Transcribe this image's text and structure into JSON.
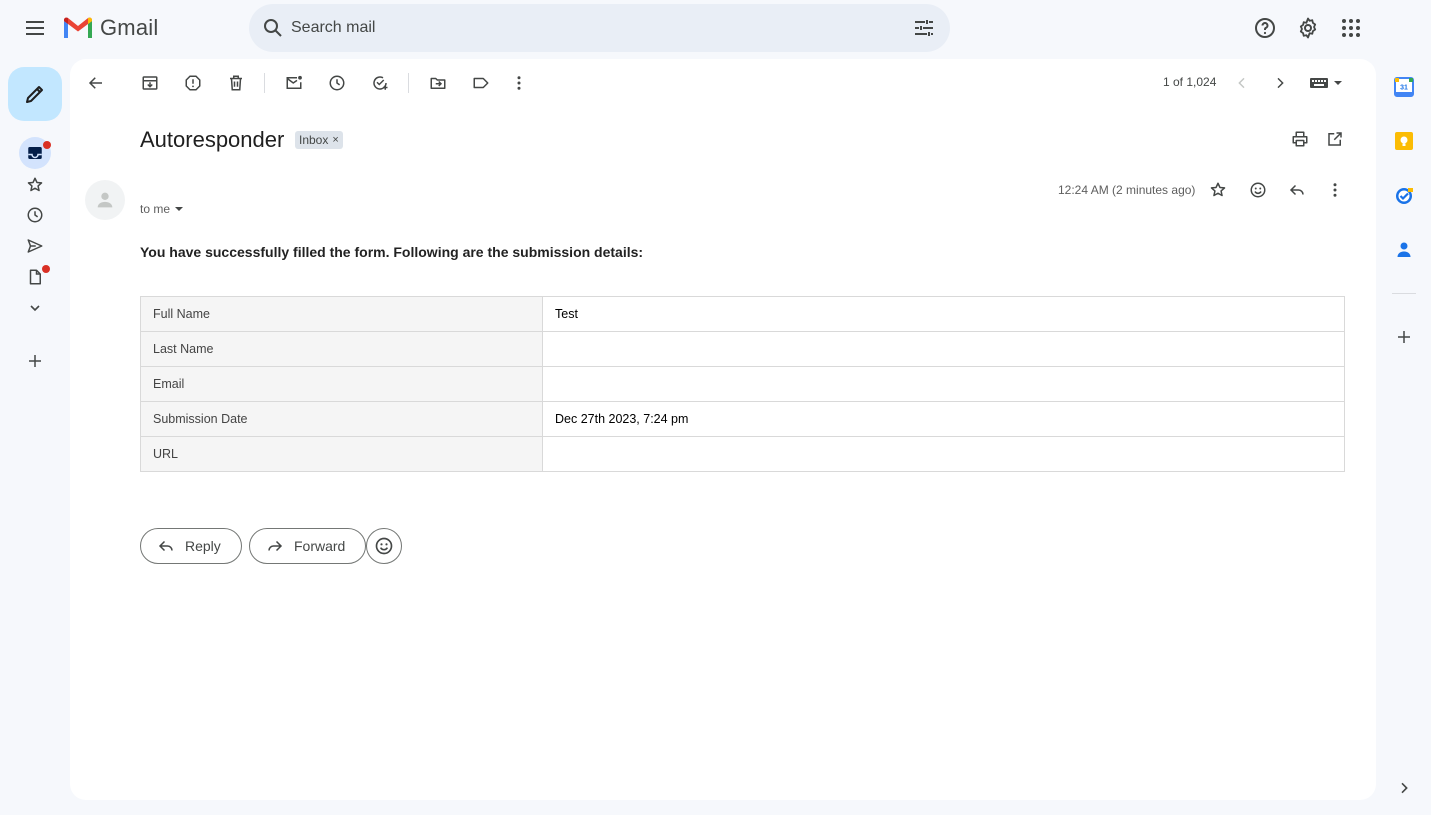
{
  "app": {
    "name": "Gmail"
  },
  "search": {
    "placeholder": "Search mail"
  },
  "toolbar": {
    "pager": "1 of 1,024"
  },
  "message": {
    "subject": "Autoresponder",
    "label": "Inbox",
    "recipient": "to me",
    "time": "12:24 AM (2 minutes ago)",
    "body_heading": "You have successfully filled the form. Following are the submission details:",
    "details": [
      {
        "key": "Full Name",
        "value": "Test"
      },
      {
        "key": "Last Name",
        "value": ""
      },
      {
        "key": "Email",
        "value": ""
      },
      {
        "key": "Submission Date",
        "value": "Dec 27th 2023, 7:24 pm"
      },
      {
        "key": "URL",
        "value": ""
      }
    ]
  },
  "actions": {
    "reply": "Reply",
    "forward": "Forward"
  },
  "side_panel": {
    "calendar_day": "31"
  },
  "colors": {
    "compose_bg": "#c2e7ff",
    "background": "#f6f8fc",
    "unread_dot": "#d93025"
  }
}
